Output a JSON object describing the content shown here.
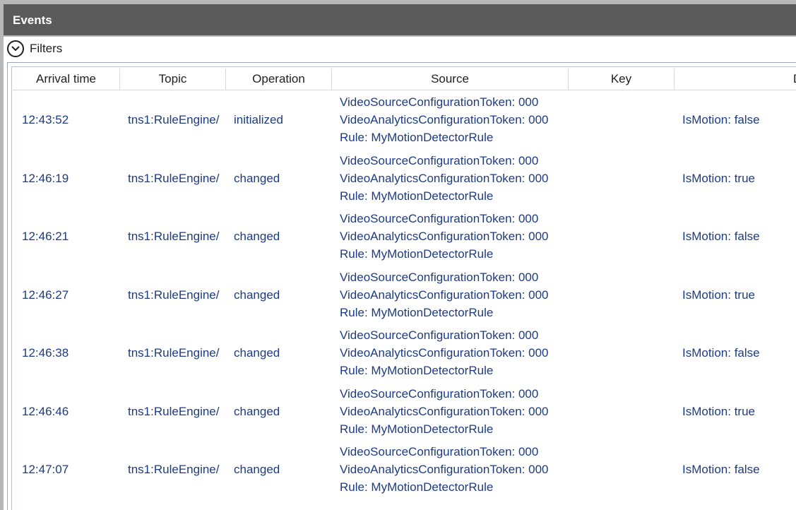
{
  "window": {
    "title": "Events"
  },
  "filters": {
    "label": "Filters",
    "icon": "chevron-down-icon"
  },
  "table": {
    "columns": [
      "Arrival time",
      "Topic",
      "Operation",
      "Source",
      "Key",
      "D"
    ],
    "rows": [
      {
        "time": "12:43:52",
        "topic": "tns1:RuleEngine/",
        "operation": "initialized",
        "source": [
          "VideoSourceConfigurationToken: 000",
          "VideoAnalyticsConfigurationToken: 000",
          "Rule: MyMotionDetectorRule"
        ],
        "data": "IsMotion: false"
      },
      {
        "time": "12:46:19",
        "topic": "tns1:RuleEngine/",
        "operation": "changed",
        "source": [
          "VideoSourceConfigurationToken: 000",
          "VideoAnalyticsConfigurationToken: 000",
          "Rule: MyMotionDetectorRule"
        ],
        "data": "IsMotion: true"
      },
      {
        "time": "12:46:21",
        "topic": "tns1:RuleEngine/",
        "operation": "changed",
        "source": [
          "VideoSourceConfigurationToken: 000",
          "VideoAnalyticsConfigurationToken: 000",
          "Rule: MyMotionDetectorRule"
        ],
        "data": "IsMotion: false"
      },
      {
        "time": "12:46:27",
        "topic": "tns1:RuleEngine/",
        "operation": "changed",
        "source": [
          "VideoSourceConfigurationToken: 000",
          "VideoAnalyticsConfigurationToken: 000",
          "Rule: MyMotionDetectorRule"
        ],
        "data": "IsMotion: true"
      },
      {
        "time": "12:46:38",
        "topic": "tns1:RuleEngine/",
        "operation": "changed",
        "source": [
          "VideoSourceConfigurationToken: 000",
          "VideoAnalyticsConfigurationToken: 000",
          "Rule: MyMotionDetectorRule"
        ],
        "data": "IsMotion: false"
      },
      {
        "time": "12:46:46",
        "topic": "tns1:RuleEngine/",
        "operation": "changed",
        "source": [
          "VideoSourceConfigurationToken: 000",
          "VideoAnalyticsConfigurationToken: 000",
          "Rule: MyMotionDetectorRule"
        ],
        "data": "IsMotion: true"
      },
      {
        "time": "12:47:07",
        "topic": "tns1:RuleEngine/",
        "operation": "changed",
        "source": [
          "VideoSourceConfigurationToken: 000",
          "VideoAnalyticsConfigurationToken: 000",
          "Rule: MyMotionDetectorRule"
        ],
        "data": "IsMotion: false"
      }
    ]
  },
  "colors": {
    "header_bg": "#5a5a5a",
    "cell_text": "#1c3b86",
    "header_text": "#1f1f1f"
  }
}
